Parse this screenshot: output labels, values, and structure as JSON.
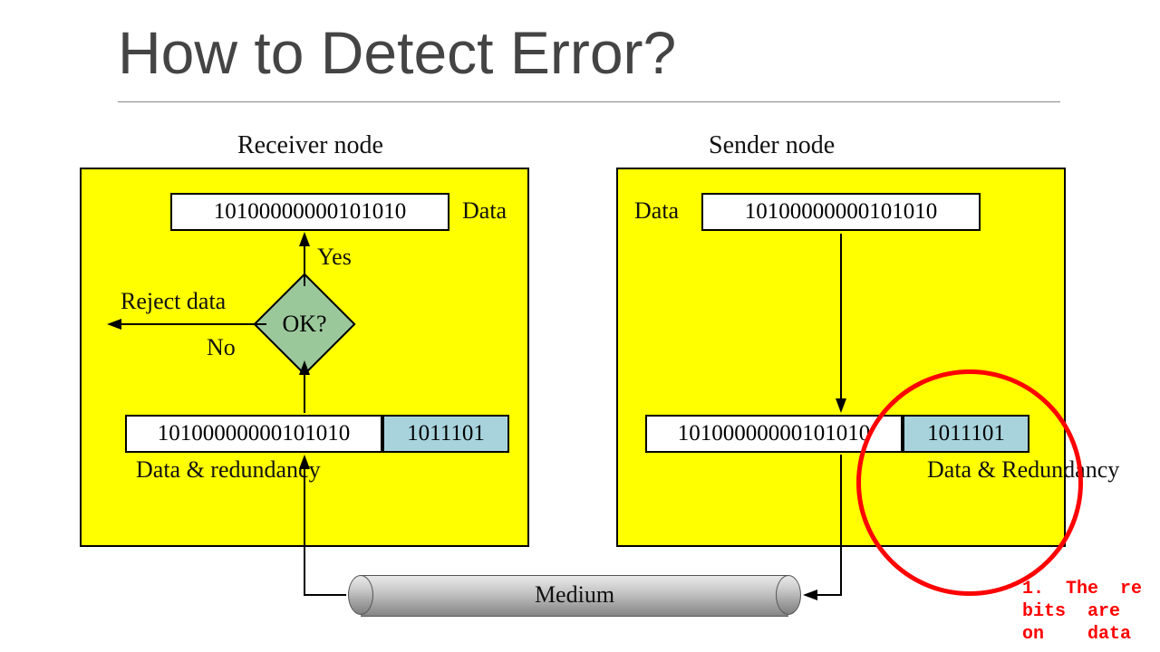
{
  "title": "How to Detect Error?",
  "receiver": {
    "label": "Receiver node",
    "data_label": "Data",
    "data_bits": "10100000000101010",
    "full_bits": "10100000000101010",
    "redundancy_bits": "1011101",
    "data_redundancy_label": "Data &\nredundancy",
    "decision": "OK?",
    "yes_label": "Yes",
    "no_label": "No",
    "reject_label": "Reject data"
  },
  "sender": {
    "label": "Sender node",
    "data_label": "Data",
    "data_bits": "10100000000101010",
    "full_bits": "10100000000101010",
    "redundancy_bits": "1011101",
    "data_redundancy_label": "Data &\nRedundancy"
  },
  "medium_label": "Medium",
  "side_note": "1.  The  re\nbits  are  \non    data  "
}
